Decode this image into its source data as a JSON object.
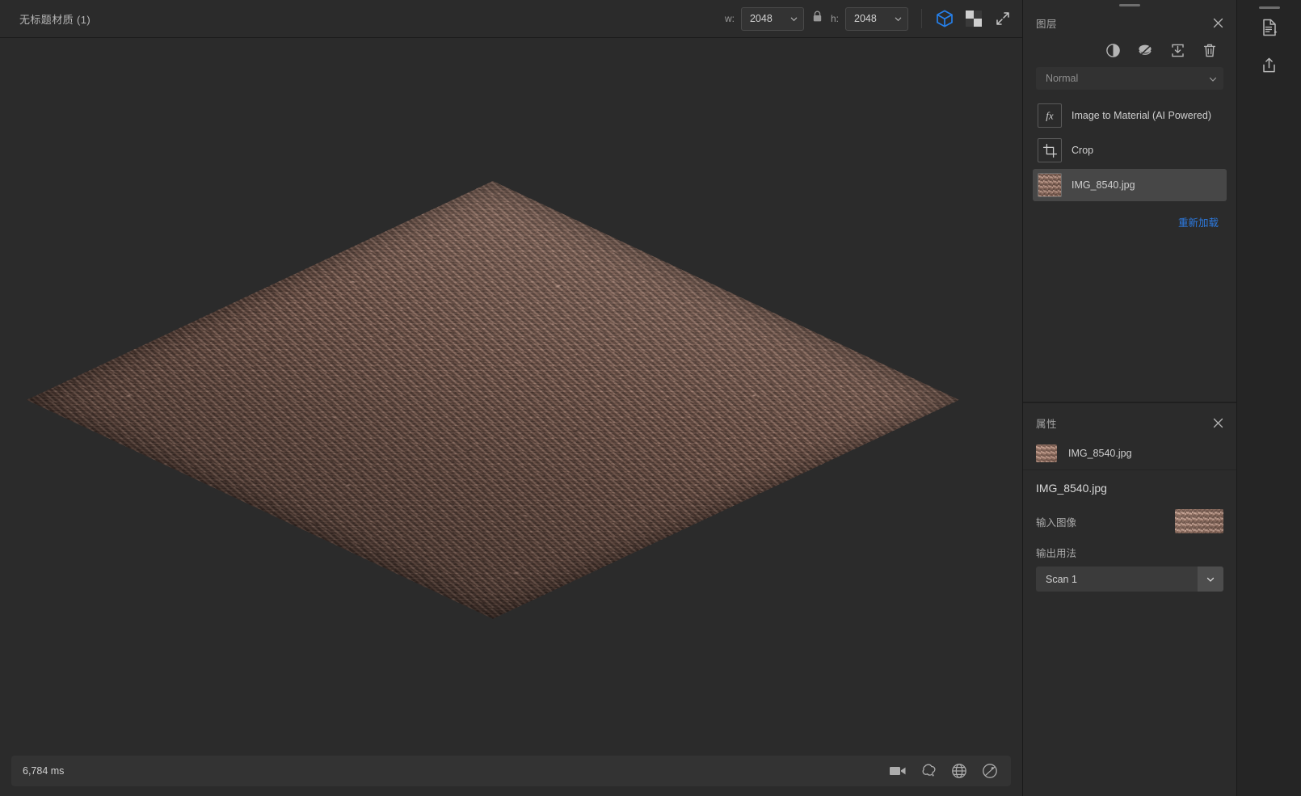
{
  "window": {
    "document_title": "无标题材质 (1)"
  },
  "toolbar": {
    "width_label": "w:",
    "width_value": "2048",
    "lock_icon": "lock-icon",
    "height_label": "h:",
    "height_value": "2048",
    "view_3d_icon": "cube-3d-icon",
    "view_2d_icon": "checkerboard-2d-icon",
    "fullscreen_icon": "expand-arrows-icon",
    "accent_blue": "#2680eb"
  },
  "layers_panel": {
    "title": "图层",
    "close_icon": "close-icon",
    "tools": [
      {
        "name": "adjustment-icon",
        "title": "adjustment"
      },
      {
        "name": "effects-icon",
        "title": "effects"
      },
      {
        "name": "import-icon",
        "title": "import"
      },
      {
        "name": "delete-icon",
        "title": "delete"
      }
    ],
    "blend_mode": "Normal",
    "items": [
      {
        "label": "Image to Material (AI Powered)",
        "icon": "fx-icon",
        "selected": false
      },
      {
        "label": "Crop",
        "icon": "crop-icon",
        "selected": false
      },
      {
        "label": "IMG_8540.jpg",
        "icon": "image-thumbnail",
        "selected": true
      }
    ],
    "reload_link": "重新加载",
    "reload_link_color": "#2c7ae0"
  },
  "properties_panel": {
    "title": "属性",
    "close_icon": "close-icon",
    "file_name": "IMG_8540.jpg",
    "heading": "IMG_8540.jpg",
    "input_image_label": "输入图像",
    "output_usage_label": "输出用法",
    "output_usage_value": "Scan 1"
  },
  "rail": {
    "buttons": [
      {
        "name": "document-edit-icon"
      },
      {
        "name": "export-icon"
      }
    ]
  },
  "statusbar": {
    "render_time": "6,784 ms",
    "icons": [
      {
        "name": "camera-icon"
      },
      {
        "name": "environment-icon"
      },
      {
        "name": "globe-grid-icon"
      },
      {
        "name": "material-sphere-icon"
      }
    ]
  },
  "viewport": {
    "background_color": "#2b2b2b",
    "material_name": "IMG_8540.jpg"
  }
}
